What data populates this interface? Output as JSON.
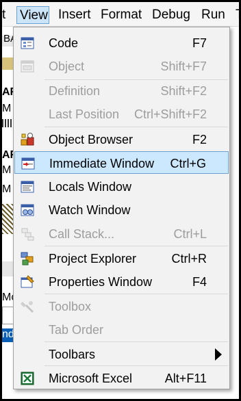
{
  "menubar": {
    "stub": "t",
    "view": "View",
    "insert": "Insert",
    "format": "Format",
    "debug": "Debug",
    "run": "Run",
    "tail": "T"
  },
  "background": {
    "rows": [
      "BA",
      "AF",
      "M",
      "AF",
      "M",
      "M",
      "Mo",
      "nd"
    ]
  },
  "view_menu": {
    "items": [
      {
        "label": "Code",
        "shortcut": "F7",
        "enabled": true,
        "icon": "code-window-icon"
      },
      {
        "label": "Object",
        "shortcut": "Shift+F7",
        "enabled": false,
        "icon": "object-icon"
      },
      {
        "label": "Definition",
        "shortcut": "Shift+F2",
        "enabled": false,
        "icon": ""
      },
      {
        "label": "Last Position",
        "shortcut": "Ctrl+Shift+F2",
        "enabled": false,
        "icon": ""
      },
      {
        "label": "Object Browser",
        "shortcut": "F2",
        "enabled": true,
        "icon": "object-browser-icon"
      },
      {
        "label": "Immediate Window",
        "shortcut": "Ctrl+G",
        "enabled": true,
        "icon": "immediate-window-icon",
        "highlighted": true
      },
      {
        "label": "Locals Window",
        "shortcut": "",
        "enabled": true,
        "icon": "locals-window-icon"
      },
      {
        "label": "Watch Window",
        "shortcut": "",
        "enabled": true,
        "icon": "watch-window-icon"
      },
      {
        "label": "Call Stack...",
        "shortcut": "Ctrl+L",
        "enabled": false,
        "icon": "call-stack-icon"
      },
      {
        "label": "Project Explorer",
        "shortcut": "Ctrl+R",
        "enabled": true,
        "icon": "project-explorer-icon"
      },
      {
        "label": "Properties Window",
        "shortcut": "F4",
        "enabled": true,
        "icon": "properties-window-icon"
      },
      {
        "label": "Toolbox",
        "shortcut": "",
        "enabled": false,
        "icon": "toolbox-icon"
      },
      {
        "label": "Tab Order",
        "shortcut": "",
        "enabled": false,
        "icon": ""
      },
      {
        "label": "Toolbars",
        "shortcut": "",
        "enabled": true,
        "icon": "",
        "submenu": true
      },
      {
        "label": "Microsoft Excel",
        "shortcut": "Alt+F11",
        "enabled": true,
        "icon": "excel-icon"
      }
    ]
  },
  "colors": {
    "highlight": "#cce8ff",
    "highlight_border": "#6a9fce",
    "disabled_text": "#9d9d9d",
    "menu_bg": "#f2f2f2"
  }
}
